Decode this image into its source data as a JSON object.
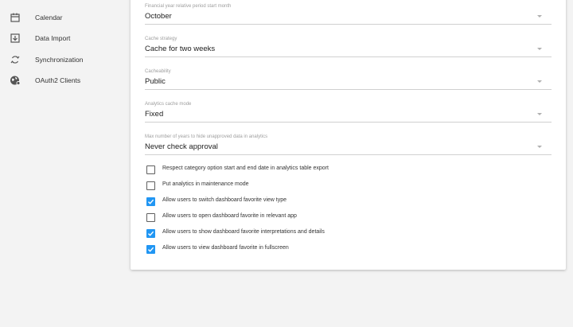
{
  "sidebar": {
    "items": [
      {
        "label": "Calendar",
        "icon": "calendar-icon"
      },
      {
        "label": "Data Import",
        "icon": "import-icon"
      },
      {
        "label": "Synchronization",
        "icon": "sync-icon"
      },
      {
        "label": "OAuth2 Clients",
        "icon": "globe-settings-icon"
      }
    ]
  },
  "fields": [
    {
      "label": "Financial year relative period start month",
      "value": "October"
    },
    {
      "label": "Cache strategy",
      "value": "Cache for two weeks"
    },
    {
      "label": "Cacheability",
      "value": "Public"
    },
    {
      "label": "Analytics cache mode",
      "value": "Fixed"
    },
    {
      "label": "Max number of years to hide unapproved data in analytics",
      "value": "Never check approval"
    }
  ],
  "checkboxes": [
    {
      "label": "Respect category option start and end date in analytics table export",
      "checked": false
    },
    {
      "label": "Put analytics in maintenance mode",
      "checked": false
    },
    {
      "label": "Allow users to switch dashboard favorite view type",
      "checked": true
    },
    {
      "label": "Allow users to open dashboard favorite in relevant app",
      "checked": false
    },
    {
      "label": "Allow users to show dashboard favorite interpretations and details",
      "checked": true
    },
    {
      "label": "Allow users to view dashboard favorite in fullscreen",
      "checked": true
    }
  ],
  "colors": {
    "accent": "#2196f3",
    "background": "#f3f3f3",
    "card": "#ffffff"
  }
}
